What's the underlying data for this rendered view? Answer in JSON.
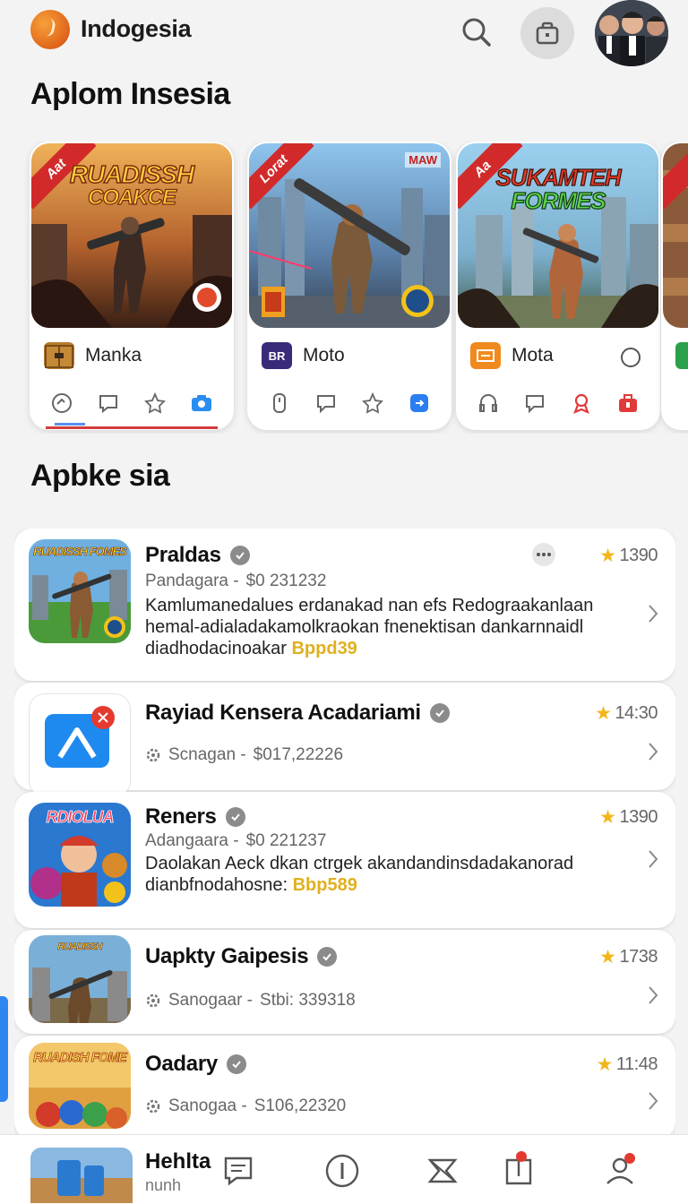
{
  "header": {
    "app_title": "Indogesia",
    "icons": [
      "logo-icon",
      "search-icon",
      "store-bag-icon",
      "avatar"
    ]
  },
  "sections": {
    "featured_title": "Aplom Insesia",
    "list_title": "Apbke sia"
  },
  "featured": [
    {
      "name": "Manka",
      "ribbon": "Aat",
      "art_title_1": "RUADISSH",
      "art_title_2": "COAKCE",
      "actions": [
        "history-icon",
        "chat-icon",
        "star-icon",
        "camera-icon"
      ]
    },
    {
      "name": "Moto",
      "ribbon": "Lorat",
      "ribbon_right": "MAW",
      "mini_icon_text": "BR",
      "actions": [
        "phone-icon",
        "chat-icon",
        "star-icon",
        "share-icon"
      ]
    },
    {
      "name": "Mota",
      "ribbon": "Aa",
      "art_title_1": "SUKAMTEH",
      "art_title_2": "FORMES",
      "actions": [
        "headphones-icon",
        "chat-icon",
        "award-icon",
        "gift-icon"
      ]
    }
  ],
  "list": [
    {
      "title": "Praldas",
      "meta_left": "Pandagara -",
      "meta_right": "$0 231232",
      "rating": "1390",
      "desc": "Kamlumanedalues erdanakad  nan efs Redograakanlaan hemal-adialadakamolkraokan fnenektisan dankarnnaidl diadhodacinoakar ",
      "desc_hl": "Bppd39",
      "icon_caption": "RUADISSH FOMES"
    },
    {
      "title": "Rayiad Kensera Acadariami",
      "meta_left": "Scnagan -",
      "meta_right": "$017,22226",
      "rating": "14:30"
    },
    {
      "title": "Reners",
      "meta_left": "Adangaara -",
      "meta_right": "$0 221237",
      "rating": "1390",
      "desc": "Daolakan Aeck dkan ctrgek akandandinsdadakanorad dianbfnodahosne: ",
      "desc_hl": "Bbp589",
      "icon_caption": "RDIOLUA"
    },
    {
      "title": "Uapkty Gaipesis",
      "meta_left": "Sanogaar -",
      "meta_right": "Stbi: 339318",
      "rating": "1738",
      "icon_caption": "RUADISSH"
    },
    {
      "title": "Oadary",
      "meta_left": "Sanogaa -",
      "meta_right": "S106,22320",
      "rating": "11:48",
      "icon_caption": "RUADISH FOME"
    }
  ],
  "bottom_nav": {
    "title": "Hehlta",
    "subtitle": "nunh",
    "items": [
      "chat-icon",
      "info-icon",
      "tag-icon",
      "bookmark-icon",
      "profile-icon"
    ]
  },
  "colors": {
    "accent_blue": "#2f86f0",
    "ribbon_red": "#d22a2a",
    "star_gold": "#f2b51b",
    "highlight_gold": "#e0b020"
  }
}
